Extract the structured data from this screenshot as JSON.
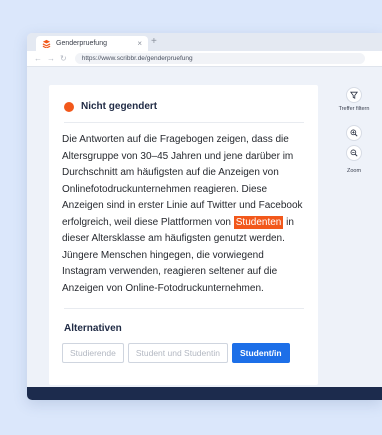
{
  "browser": {
    "tab_title": "Genderpruefung",
    "url": "https://www.scribbr.de/genderpruefung",
    "brand_color": "#f2581b"
  },
  "status": {
    "label": "Nicht gegendert",
    "color": "#f2581b"
  },
  "paragraph": {
    "before": "Die Antworten auf die Fragebogen zeigen, dass die Altersgruppe von 30–45 Jahren und jene darüber im Durchschnitt am häufigsten auf die Anzeigen von Onlinefotodruckunternehmen reagieren. Diese Anzeigen sind in erster Linie auf Twitter und Facebook erfolgreich, weil diese Plattformen von ",
    "highlight": "Studenten",
    "after": " in dieser Altersklasse am häufigsten genutzt werden. Jüngere Menschen hingegen, die vorwiegend Instagram verwenden, reagieren seltener auf die Anzeigen von Online-Fotodruckunternehmen."
  },
  "alternatives": {
    "title": "Alternativen",
    "options": [
      "Studierende",
      "Student und Studentin",
      "Student/in"
    ],
    "selected": "Student/in",
    "accent": "#1d6fe8"
  },
  "tools": {
    "filter_label": "Treffer filtern",
    "zoom_label": "Zoom"
  }
}
